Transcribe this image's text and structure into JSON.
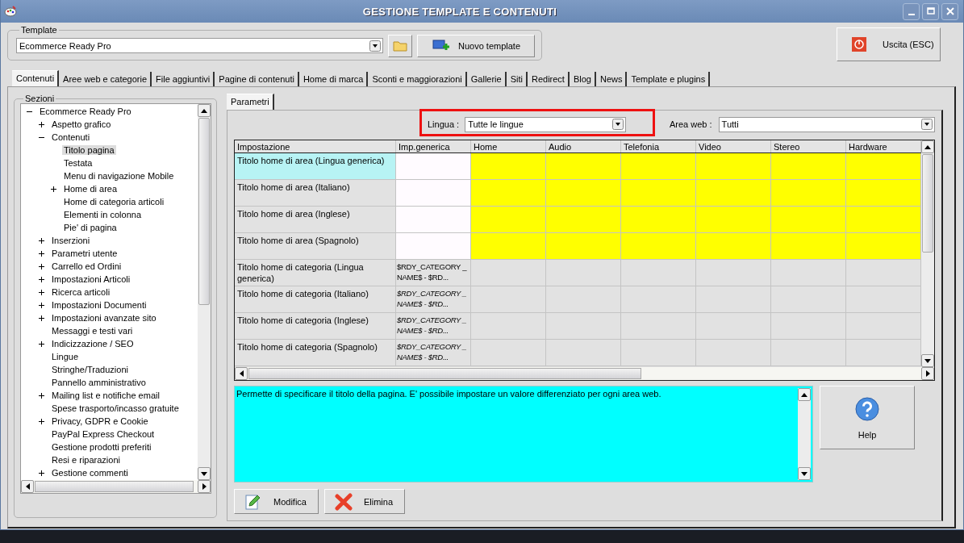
{
  "window": {
    "title": "GESTIONE TEMPLATE E CONTENUTI"
  },
  "template": {
    "label": "Template",
    "value": "Ecommerce Ready Pro",
    "new_button": "Nuovo template"
  },
  "exit_button": "Uscita (ESC)",
  "tabs": [
    {
      "label": "Contenuti",
      "selected": true
    },
    {
      "label": "Aree web e categorie",
      "selected": false
    },
    {
      "label": "File aggiuntivi",
      "selected": false
    },
    {
      "label": "Pagine di contenuti",
      "selected": false
    },
    {
      "label": "Home di marca",
      "selected": false
    },
    {
      "label": "Sconti e maggiorazioni",
      "selected": false
    },
    {
      "label": "Gallerie",
      "selected": false
    },
    {
      "label": "Siti",
      "selected": false
    },
    {
      "label": "Redirect",
      "selected": false
    },
    {
      "label": "Blog",
      "selected": false
    },
    {
      "label": "News",
      "selected": false
    },
    {
      "label": "Template e plugins",
      "selected": false
    }
  ],
  "sections": {
    "label": "Sezioni",
    "tree": [
      {
        "label": "Ecommerce Ready Pro",
        "expanded": true,
        "selected": false,
        "children": [
          {
            "label": "Aspetto grafico",
            "expanded": false,
            "selected": false
          },
          {
            "label": "Contenuti",
            "expanded": true,
            "selected": false,
            "children": [
              {
                "label": "Titolo pagina",
                "selected": true
              },
              {
                "label": "Testata",
                "selected": false
              },
              {
                "label": "Menu di navigazione Mobile",
                "selected": false
              },
              {
                "label": "Home di area",
                "expanded": false,
                "selected": false
              },
              {
                "label": "Home di categoria articoli",
                "selected": false
              },
              {
                "label": "Elementi in colonna",
                "selected": false
              },
              {
                "label": "Pie' di pagina",
                "selected": false
              }
            ]
          },
          {
            "label": "Inserzioni",
            "expanded": false,
            "selected": false
          },
          {
            "label": "Parametri utente",
            "expanded": false,
            "selected": false
          },
          {
            "label": "Carrello ed Ordini",
            "expanded": false,
            "selected": false
          },
          {
            "label": "Impostazioni Articoli",
            "expanded": false,
            "selected": false
          },
          {
            "label": "Ricerca articoli",
            "expanded": false,
            "selected": false
          },
          {
            "label": "Impostazioni Documenti",
            "expanded": false,
            "selected": false
          },
          {
            "label": "Impostazioni avanzate sito",
            "expanded": false,
            "selected": false
          },
          {
            "label": "Messaggi e testi vari",
            "selected": false
          },
          {
            "label": "Indicizzazione / SEO",
            "expanded": false,
            "selected": false
          },
          {
            "label": "Lingue",
            "selected": false
          },
          {
            "label": "Stringhe/Traduzioni",
            "selected": false
          },
          {
            "label": "Pannello amministrativo",
            "selected": false
          },
          {
            "label": "Mailing list e notifiche email",
            "expanded": false,
            "selected": false
          },
          {
            "label": "Spese trasporto/incasso gratuite",
            "selected": false
          },
          {
            "label": "Privacy, GDPR e Cookie",
            "expanded": false,
            "selected": false
          },
          {
            "label": "PayPal Express Checkout",
            "selected": false
          },
          {
            "label": "Gestione prodotti preferiti",
            "selected": false
          },
          {
            "label": "Resi e riparazioni",
            "selected": false
          },
          {
            "label": "Gestione commenti",
            "expanded": false,
            "selected": false
          }
        ]
      }
    ]
  },
  "subtabs": [
    {
      "label": "Parametri",
      "selected": true
    }
  ],
  "filters": {
    "language_label": "Lingua :",
    "language": "Tutte le lingue",
    "language_highlighted": true,
    "area_label": "Area web :",
    "area": "Tutti"
  },
  "table": {
    "columns": [
      "Impostazione",
      "Imp.generica",
      "Home",
      "Audio",
      "Telefonia",
      "Video",
      "Stereo",
      "Hardware"
    ],
    "rows": [
      {
        "label": "Titolo home di area (Lingua generica)",
        "selected": true,
        "areas_highlighted": true
      },
      {
        "label": "Titolo home di area (Italiano)",
        "selected": false,
        "areas_highlighted": true
      },
      {
        "label": "Titolo home di area (Inglese)",
        "selected": false,
        "areas_highlighted": true
      },
      {
        "label": "Titolo home di area (Spagnolo)",
        "selected": false,
        "areas_highlighted": true
      },
      {
        "label": "Titolo home di categoria (Lingua generica)",
        "generic": "$RDY_CATEGORY _NAME$ - $RD...",
        "inherited": false,
        "selected": false,
        "areas_highlighted": false
      },
      {
        "label": "Titolo home di categoria (Italiano)",
        "generic": "$RDY_CATEGORY _NAME$ - $RD...",
        "inherited": true,
        "selected": false,
        "areas_highlighted": false
      },
      {
        "label": "Titolo home di categoria (Inglese)",
        "generic": "$RDY_CATEGORY _NAME$ - $RD...",
        "inherited": true,
        "selected": false,
        "areas_highlighted": false
      },
      {
        "label": "Titolo home di categoria (Spagnolo)",
        "generic": "$RDY_CATEGORY _NAME$ - $RD...",
        "inherited": true,
        "selected": false,
        "areas_highlighted": false
      }
    ]
  },
  "description": "Permette di specificare il titolo della pagina. E' possibile impostare un valore differenziato per ogni area web.",
  "buttons": {
    "help": "Help",
    "edit": "Modifica",
    "delete": "Elimina"
  }
}
